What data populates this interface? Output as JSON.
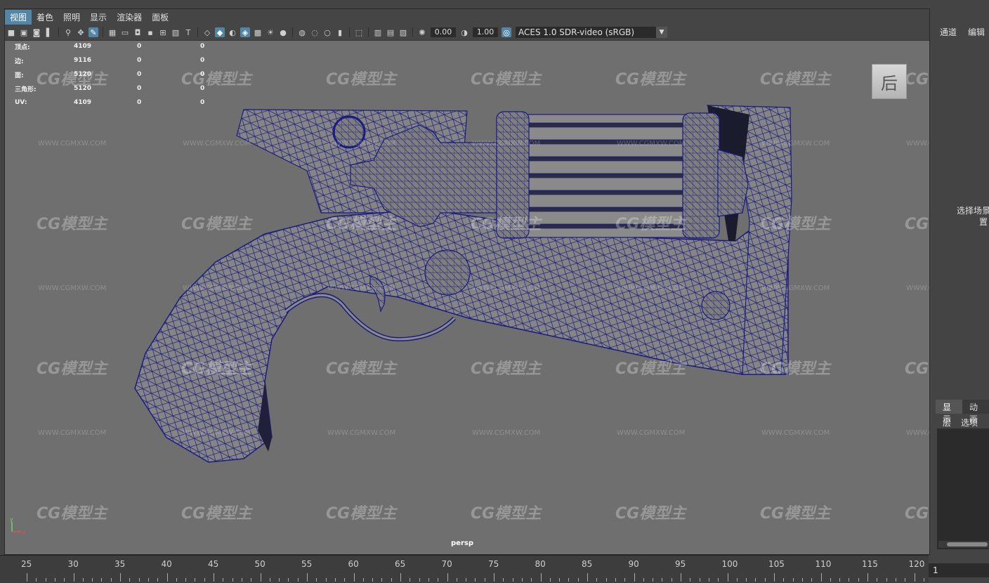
{
  "menu": [
    "视图",
    "着色",
    "照明",
    "显示",
    "渲染器",
    "面板"
  ],
  "toolbar": {
    "field1": "0.00",
    "field2": "1.00",
    "colorspace": "ACES 1.0 SDR-video (sRGB)"
  },
  "hud": {
    "rows": [
      {
        "label": "顶点:",
        "v1": "4109",
        "v2": "0",
        "v3": "0"
      },
      {
        "label": "边:",
        "v1": "9116",
        "v2": "0",
        "v3": "0"
      },
      {
        "label": "面:",
        "v1": "5120",
        "v2": "0",
        "v3": "0"
      },
      {
        "label": "三角形:",
        "v1": "5120",
        "v2": "0",
        "v3": "0"
      },
      {
        "label": "UV:",
        "v1": "4109",
        "v2": "0",
        "v3": "0"
      }
    ]
  },
  "view_cube_label": "后",
  "camera": "persp",
  "axis": {
    "y": "y",
    "x": "x"
  },
  "watermark": {
    "logo": "CG模型主",
    "url": "WWW.CGMXW.COM"
  },
  "right_panel": {
    "tab_channels": "通道",
    "tab_edit": "编辑",
    "hint_line1": "选择场景",
    "hint_line2": "置",
    "bottom_tabs": [
      "显示",
      "动画"
    ],
    "layer_menu": [
      "层",
      "选项"
    ]
  },
  "timeline": {
    "ticks": [
      "25",
      "30",
      "35",
      "40",
      "45",
      "50",
      "55",
      "60",
      "65",
      "70",
      "75",
      "80",
      "85",
      "90",
      "95",
      "100",
      "105",
      "110",
      "115",
      "120"
    ],
    "current_frame": "1"
  },
  "colors": {
    "viewport_bg": "#6f6f6f",
    "wire": "#1a1a7a",
    "mesh": "#7a7a7a",
    "highlight": "#5285a6"
  }
}
